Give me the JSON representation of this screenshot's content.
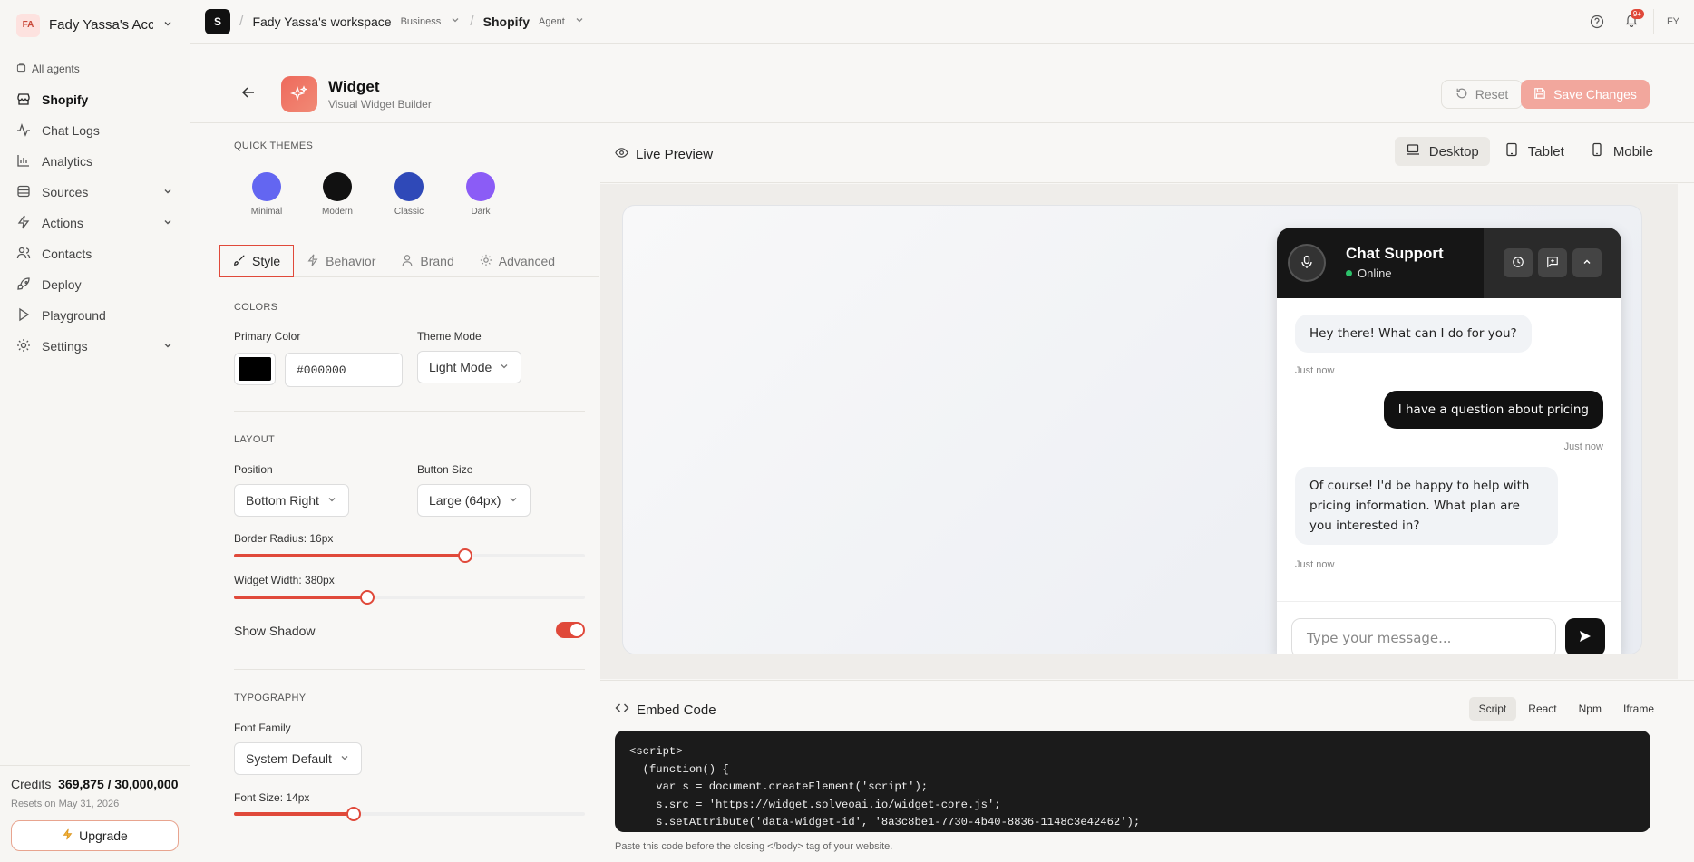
{
  "account": {
    "initials": "FA",
    "name": "Fady Yassa's Acco..."
  },
  "sidebar": {
    "all_agents": "All agents",
    "items": [
      {
        "label": "Shopify",
        "icon": "store-icon",
        "active": true
      },
      {
        "label": "Chat Logs",
        "icon": "activity-icon"
      },
      {
        "label": "Analytics",
        "icon": "bar-chart-icon"
      },
      {
        "label": "Sources",
        "icon": "database-icon",
        "expandable": true
      },
      {
        "label": "Actions",
        "icon": "zap-icon",
        "expandable": true
      },
      {
        "label": "Contacts",
        "icon": "users-icon"
      },
      {
        "label": "Deploy",
        "icon": "rocket-icon"
      },
      {
        "label": "Playground",
        "icon": "play-icon"
      },
      {
        "label": "Settings",
        "icon": "gear-icon",
        "expandable": true
      }
    ],
    "credits_label": "Credits",
    "credits_value": "369,875 / 30,000,000",
    "resets": "Resets on May 31, 2026",
    "upgrade": "Upgrade"
  },
  "topbar": {
    "logo": "S",
    "workspace": "Fady Yassa's workspace",
    "plan": "Business",
    "agent": "Shopify",
    "agent_tag": "Agent",
    "notif_badge": "9+",
    "user_initials": "FY"
  },
  "header": {
    "title": "Widget",
    "subtitle": "Visual Widget Builder",
    "reset": "Reset",
    "save": "Save Changes"
  },
  "settings": {
    "quick_themes_title": "Quick Themes",
    "themes": [
      {
        "label": "Minimal",
        "color": "#6366f1"
      },
      {
        "label": "Modern",
        "color": "#111111"
      },
      {
        "label": "Classic",
        "color": "#2f49b8"
      },
      {
        "label": "Dark",
        "color": "#8b5cf6"
      }
    ],
    "tabs": [
      "Style",
      "Behavior",
      "Brand",
      "Advanced"
    ],
    "colors_title": "Colors",
    "primary_color_label": "Primary Color",
    "primary_color_value": "#000000",
    "theme_mode_label": "Theme Mode",
    "theme_mode_value": "Light Mode",
    "layout_title": "Layout",
    "position_label": "Position",
    "position_value": "Bottom Right",
    "button_size_label": "Button Size",
    "button_size_value": "Large (64px)",
    "border_radius_label": "Border Radius: 16px",
    "border_radius_fraction": 0.66,
    "widget_width_label": "Widget Width: 380px",
    "widget_width_fraction": 0.38,
    "show_shadow_label": "Show Shadow",
    "show_shadow": true,
    "typography_title": "Typography",
    "font_family_label": "Font Family",
    "font_family_value": "System Default",
    "font_size_label": "Font Size: 14px",
    "font_size_fraction": 0.34
  },
  "preview": {
    "title": "Live Preview",
    "devices": [
      "Desktop",
      "Tablet",
      "Mobile"
    ],
    "chat": {
      "name": "Chat Support",
      "status": "Online",
      "messages": [
        {
          "from": "bot",
          "text": "Hey there! What can I do for you?",
          "time": "Just now"
        },
        {
          "from": "user",
          "text": "I have a question about pricing",
          "time": "Just now"
        },
        {
          "from": "bot",
          "text": "Of course! I'd be happy to help with pricing information. What plan are you interested in?",
          "time": "Just now"
        }
      ],
      "placeholder": "Type your message..."
    }
  },
  "embed": {
    "title": "Embed Code",
    "tabs": [
      "Script",
      "React",
      "Npm",
      "Iframe"
    ],
    "code": "<script>\n  (function() {\n    var s = document.createElement('script');\n    s.src = 'https://widget.solveoai.io/widget-core.js';\n    s.setAttribute('data-widget-id', '8a3c8be1-7730-4b40-8836-1148c3e42462');",
    "hint": "Paste this code before the closing </body> tag of your website."
  },
  "colors": {
    "accent": "#e0493a",
    "save_disabled": "#f2a79d"
  }
}
